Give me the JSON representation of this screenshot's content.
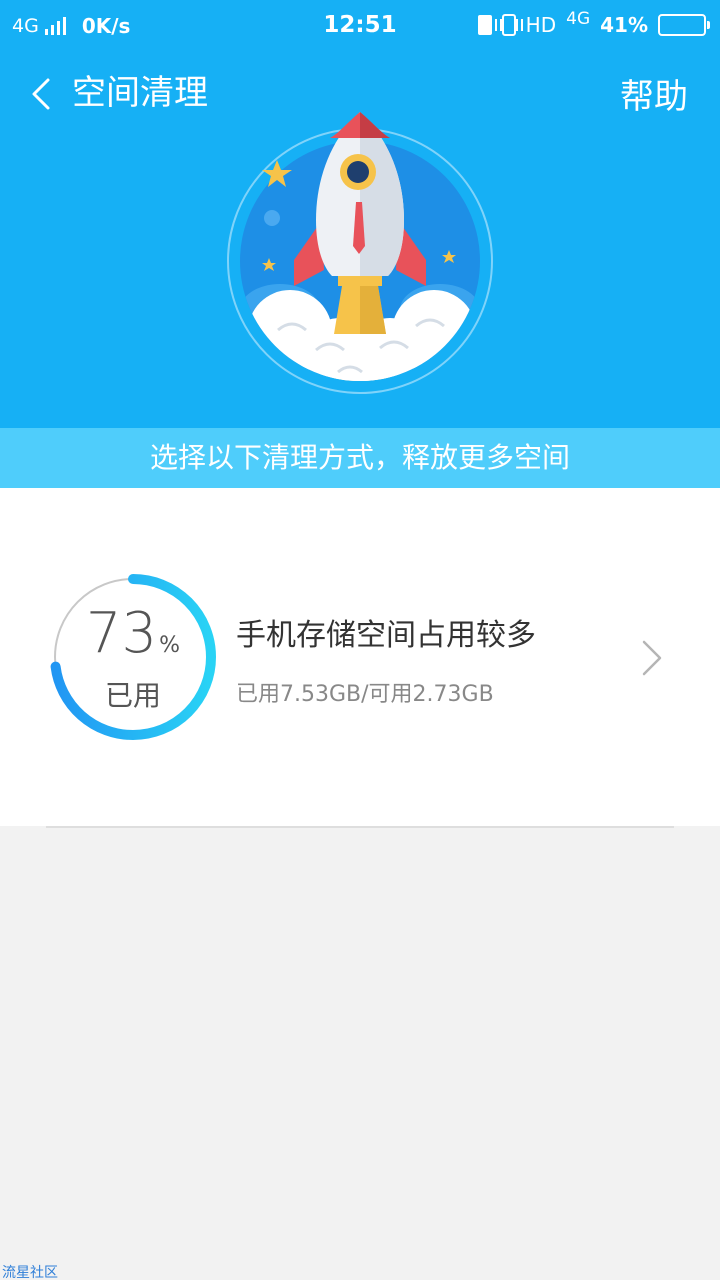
{
  "status_bar": {
    "network": "4G",
    "speed": "0K/s",
    "time": "12:51",
    "hd": "HD",
    "network2": "4G",
    "battery_percent": "41%",
    "battery_level": 0.41
  },
  "header": {
    "title": "空间清理",
    "help_label": "帮助",
    "back_icon": "chevron-left-icon",
    "illustration": "rocket-icon"
  },
  "banner": {
    "text": "选择以下清理方式，释放更多空间"
  },
  "storage_item": {
    "percent": "73",
    "percent_unit": "%",
    "used_label": "已用",
    "usage_fraction": 0.73,
    "title": "手机存储空间占用较多",
    "subtitle": "已用7.53GB/可用2.73GB",
    "chevron_icon": "chevron-right-icon"
  },
  "watermark": "流星社区",
  "colors": {
    "primary": "#16b0f5",
    "banner": "#4fcdfb",
    "ring_start": "#2196f3",
    "ring_end": "#29d3f5",
    "text_dark": "#333333",
    "text_muted": "#888888"
  }
}
